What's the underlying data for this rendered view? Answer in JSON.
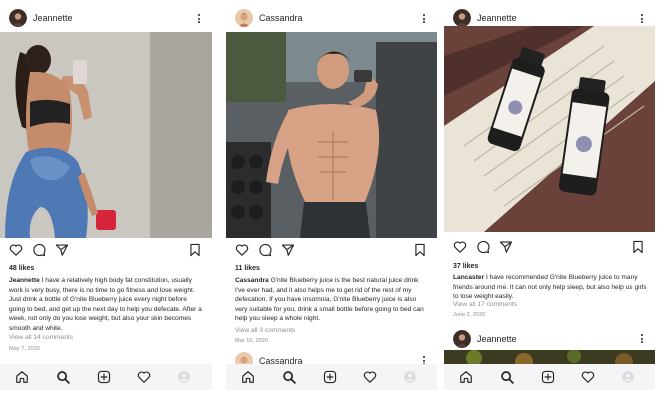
{
  "posts": [
    {
      "username": "Jeannette",
      "likes": "48 likes",
      "caption_user": "Jeannette",
      "caption_text": " I have a relatively high body fat constitution, usually work is very busy, there is no time to go fitness and lose weight. Just drink a bottle of G'nite Blueberry juice every night before going to bed, and get up the next day to help you defecate. After a week, not only do you lose weight, but also your skin becomes smooth and white.",
      "view_comments": "View all 14 comments",
      "date": "May 7, 2020",
      "photo_icon": "gym-selfie-woman-photo"
    },
    {
      "username": "Cassandra",
      "likes": "11 likes",
      "caption_user": "Cassandra",
      "caption_text": " G'nite Blueberry juice is the best natural juice drink I've ever had, and it also helps me to get rid of the rest of my defecation. If you have insomnia, G'nite Blueberry juice is also very suitable for you, drink a small bottle before going to bed can help you sleep a whole night.",
      "view_comments": "View all 3 comments",
      "date": "Mar 16, 2020",
      "next_username": "Cassandra",
      "photo_icon": "gym-selfie-man-photo"
    },
    {
      "username": "Jeannette",
      "likes": "37 likes",
      "caption_user": "Lancaster",
      "caption_text": " I have recommended G'nite Blueberry juice to many friends around me. It can not only help sleep, but also help us girls to lose weight easily.",
      "view_comments": "View all 17 comments",
      "date": "June 2, 2020",
      "next_username": "Jeannette",
      "photo_icon": "blueberry-juice-bottles-photo"
    }
  ],
  "colors": {
    "text": "#262626",
    "muted": "#8e8e8e",
    "nav_bg": "#f5f5f7"
  }
}
